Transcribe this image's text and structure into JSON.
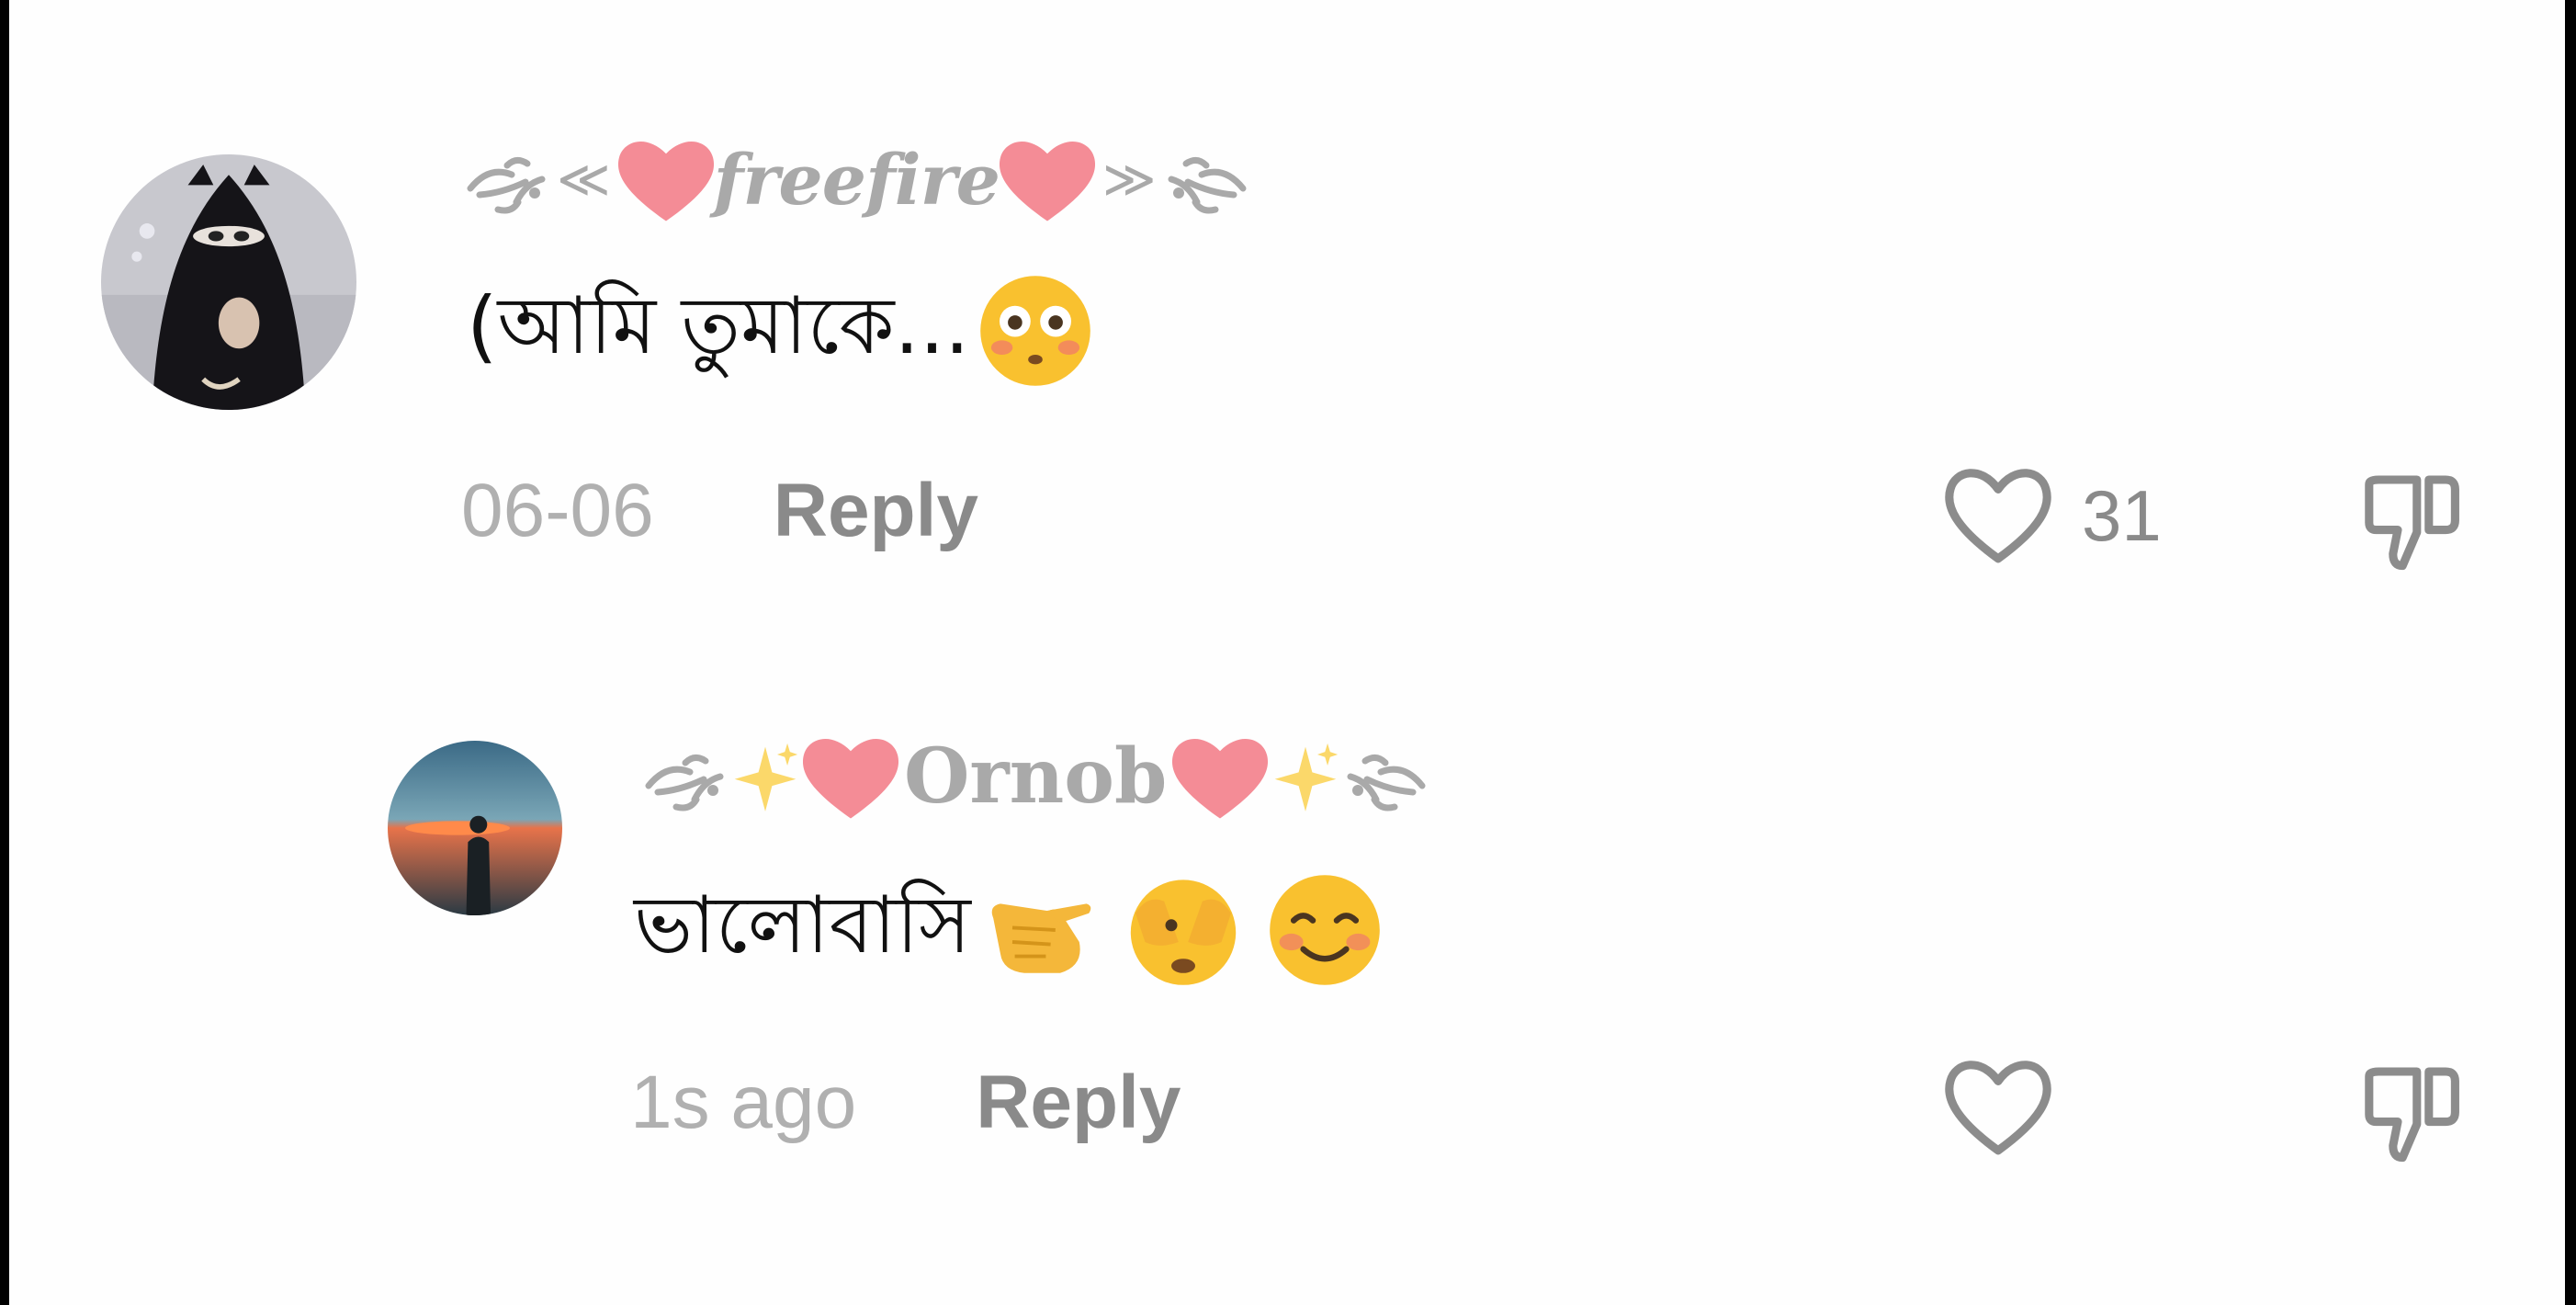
{
  "comments": [
    {
      "username": "freefire",
      "text": "(আমি তুমাকে...",
      "emoji": "flushed-face-emoji",
      "time": "06-06",
      "reply_label": "Reply",
      "like_count": "31"
    },
    {
      "username": "Ornob",
      "text": "ভালোবাসি",
      "emoji": [
        "pointing-hand-emoji",
        "face-covering-eyes-emoji",
        "smiling-face-emoji"
      ],
      "time": "1s ago",
      "reply_label": "Reply"
    }
  ],
  "colors": {
    "background": "#fefefe",
    "muted_text": "#a9a9a9",
    "reply_text": "#8a8a8a",
    "heart_emoji": "#f48c96",
    "icon_stroke": "#8c8c8c"
  }
}
